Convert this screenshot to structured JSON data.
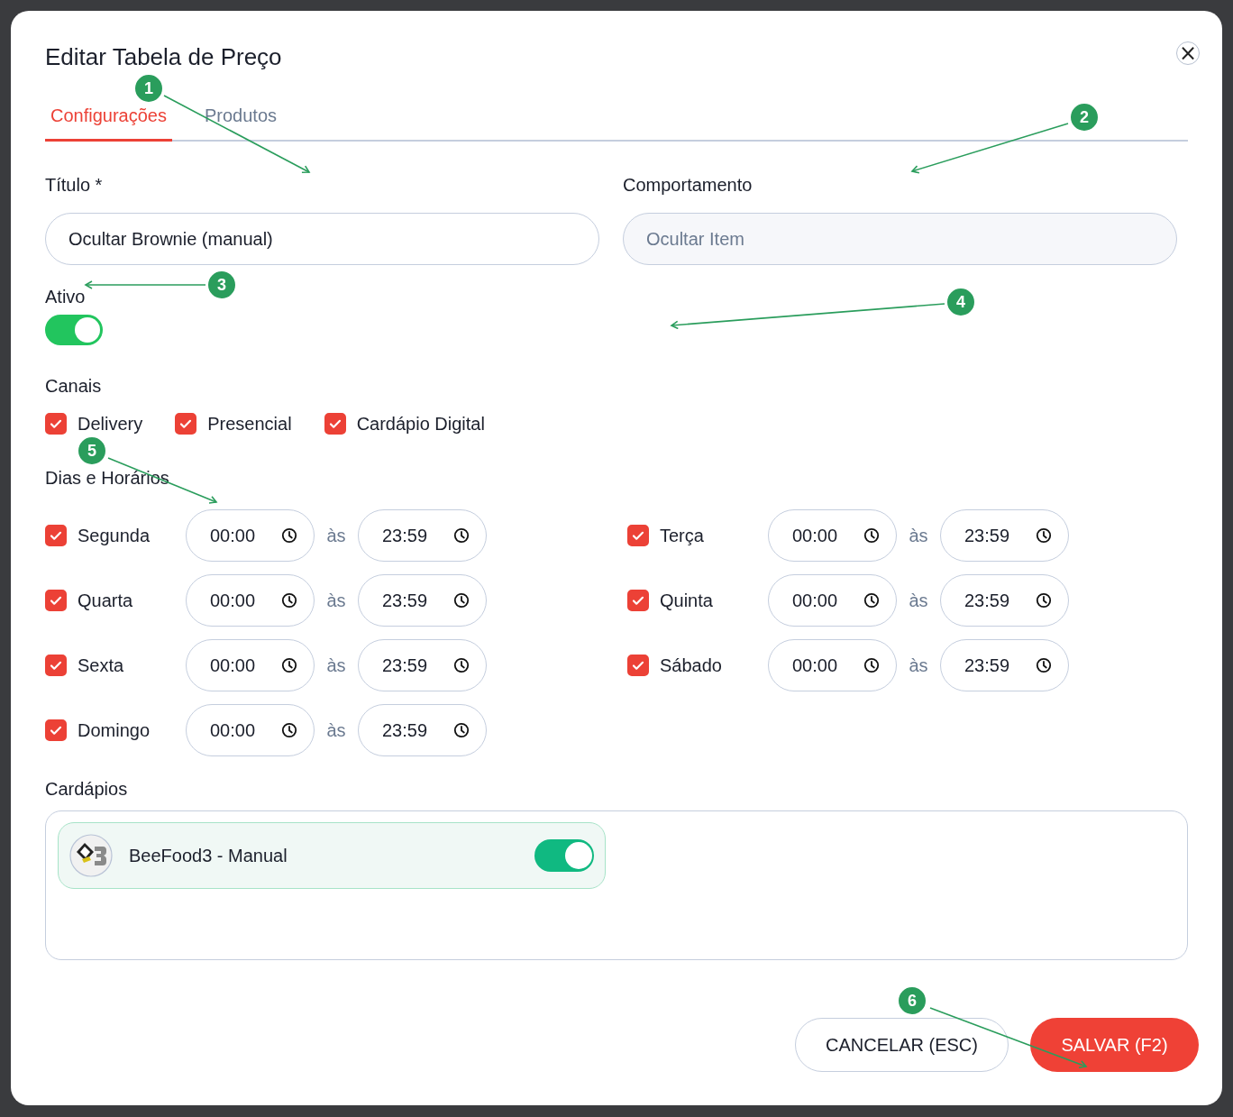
{
  "dialog": {
    "title": "Editar Tabela de Preço",
    "close": "×"
  },
  "tabs": [
    {
      "label": "Configurações",
      "selected": true
    },
    {
      "label": "Produtos",
      "selected": false
    }
  ],
  "fields": [
    {
      "label": "Título *",
      "value": "Ocultar Brownie (manual)",
      "disabled": false
    },
    {
      "label": "Comportamento",
      "value": "Ocultar Item",
      "disabled": true
    }
  ],
  "active": {
    "label": "Ativo",
    "on": true
  },
  "channels": {
    "label": "Canais",
    "items": [
      {
        "label": "Delivery",
        "checked": true
      },
      {
        "label": "Presencial",
        "checked": true
      },
      {
        "label": "Cardápio Digital",
        "checked": true
      }
    ]
  },
  "schedule": {
    "label": "Dias e Horários",
    "days": [
      {
        "label": "Segunda",
        "checked": true,
        "from": "00:00",
        "separator": "às",
        "to": "23:59"
      },
      {
        "label": "Terça",
        "checked": true,
        "from": "00:00",
        "separator": "às",
        "to": "23:59"
      },
      {
        "label": "Quarta",
        "checked": true,
        "from": "00:00",
        "separator": "às",
        "to": "23:59"
      },
      {
        "label": "Quinta",
        "checked": true,
        "from": "00:00",
        "separator": "às",
        "to": "23:59"
      },
      {
        "label": "Sexta",
        "checked": true,
        "from": "00:00",
        "separator": "às",
        "to": "23:59"
      },
      {
        "label": "Sábado",
        "checked": true,
        "from": "00:00",
        "separator": "às",
        "to": "23:59"
      },
      {
        "label": "Domingo",
        "checked": true,
        "from": "00:00",
        "separator": "às",
        "to": "23:59"
      }
    ]
  },
  "menus": {
    "label": "Cardápios",
    "items": [
      {
        "name": "BeeFood3 - Manual",
        "on": true
      }
    ]
  },
  "buttons": [
    {
      "label": "CANCELAR (ESC)",
      "kind": "secondary"
    },
    {
      "label": "SALVAR (F2)",
      "kind": "primary"
    }
  ],
  "annotations": [
    {
      "label": "1"
    },
    {
      "label": "2"
    },
    {
      "label": "3"
    },
    {
      "label": "4"
    },
    {
      "label": "5"
    },
    {
      "label": "6"
    }
  ]
}
